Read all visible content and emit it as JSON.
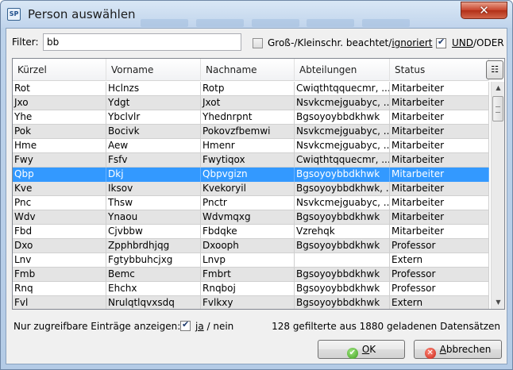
{
  "window": {
    "title": "Person auswählen",
    "app_icon_text": "SP",
    "close_glyph": "✕"
  },
  "filter": {
    "label": "Filter:",
    "value": "bb",
    "case_sensitive_checked": false,
    "case_label_prefix": "Groß-/Kleinschr. beachtet/",
    "case_label_underlined": "ignoriert",
    "und_checked": true,
    "und_underlined": "UND",
    "und_rest": "/ODER"
  },
  "table": {
    "columns": [
      "Kürzel",
      "Vorname",
      "Nachname",
      "Abteilungen",
      "Status"
    ],
    "column_chooser_icon": "column-chooser-icon",
    "selected_row": 6,
    "rows": [
      [
        "Rot",
        "Hclnzs",
        "Rotp",
        "Cwiqthtqquecmr, ...",
        "Mitarbeiter"
      ],
      [
        "Jxo",
        "Ydgt",
        "Jxot",
        "Nsvkcmejguabyc, ...",
        "Mitarbeiter"
      ],
      [
        "Yhe",
        "Ybclvlr",
        "Yhednrpnt",
        "Bgsoyoybbdkhwk",
        "Mitarbeiter"
      ],
      [
        "Pok",
        "Bocivk",
        "Pokovzfbemwi",
        "Nsvkcmejguabyc, ...",
        "Mitarbeiter"
      ],
      [
        "Hme",
        "Aew",
        "Hmenr",
        "Nsvkcmejguabyc, ...",
        "Mitarbeiter"
      ],
      [
        "Fwy",
        "Fsfv",
        "Fwytiqox",
        "Cwiqthtqquecmr, ...",
        "Mitarbeiter"
      ],
      [
        "Qbp",
        "Dkj",
        "Qbpvgizn",
        "Bgsoyoybbdkhwk",
        "Mitarbeiter"
      ],
      [
        "Kve",
        "Iksov",
        "Kvekoryil",
        "Bgsoyoybbdkhwk, ...",
        "Mitarbeiter"
      ],
      [
        "Pnc",
        "Thsw",
        "Pnctr",
        "Nsvkcmejguabyc, ...",
        "Mitarbeiter"
      ],
      [
        "Wdv",
        "Ynaou",
        "Wdvmqxg",
        "Bgsoyoybbdkhwk",
        "Mitarbeiter"
      ],
      [
        "Fbd",
        "Cjvbbw",
        "Fbdqke",
        "Vzrehqk",
        "Mitarbeiter"
      ],
      [
        "Dxo",
        "Zpphbrdhjqg",
        "Dxooph",
        "Bgsoyoybbdkhwk",
        "Professor"
      ],
      [
        "Lnv",
        "Fgtybbuhcjxg",
        "Lnvp",
        "",
        "Extern"
      ],
      [
        "Fmb",
        "Bemc",
        "Fmbrt",
        "Bgsoyoybbdkhwk",
        "Professor"
      ],
      [
        "Rnq",
        "Ehchx",
        "Rnqboj",
        "Bgsoyoybbdkhwk",
        "Professor"
      ],
      [
        "Fvl",
        "Nrulqtlqvxsdq",
        "Fvlkxy",
        "Bgsoyoybbdkhwk",
        "Extern"
      ]
    ]
  },
  "footer": {
    "access_label": "Nur zugreifbare Einträge anzeigen:",
    "ja_checked": true,
    "ja_label": "ja",
    "nein_label": " / nein",
    "count_text": "128 gefilterte aus 1880 geladenen Datensätzen"
  },
  "buttons": {
    "ok_underlined": "O",
    "ok_rest": "K",
    "ok_icon": "ok-check-icon",
    "cancel_underlined": "A",
    "cancel_rest": "bbrechen",
    "cancel_icon": "cancel-x-icon"
  },
  "colors": {
    "selection": "#3399ff",
    "alt_row": "#e4e4e4",
    "close_button": "#c7432b"
  }
}
